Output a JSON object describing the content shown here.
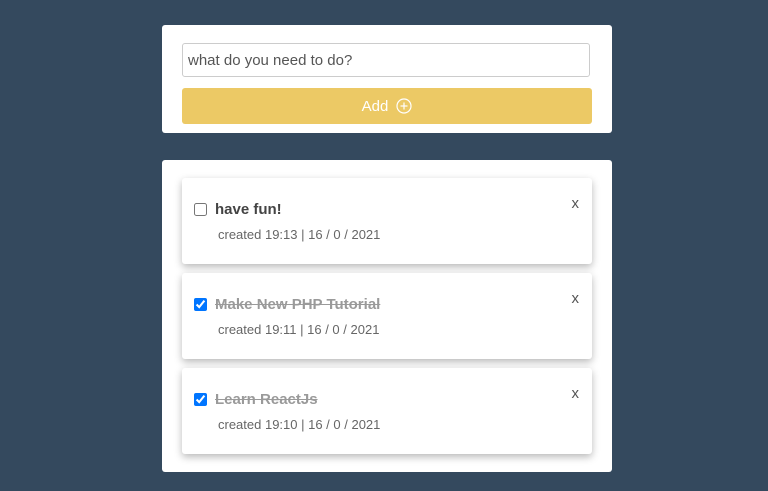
{
  "add_form": {
    "input_placeholder": "what do you need to do?",
    "input_value": "",
    "add_label": "Add",
    "add_icon": "plus-circle-icon"
  },
  "todos": [
    {
      "title": "have fun!",
      "created": "created 19:13 | 16 / 0 / 2021",
      "done": false,
      "delete_label": "x"
    },
    {
      "title": "Make New PHP Tutorial",
      "created": "created 19:11 | 16 / 0 / 2021",
      "done": true,
      "delete_label": "x"
    },
    {
      "title": "Learn ReactJs",
      "created": "created 19:10 | 16 / 0 / 2021",
      "done": true,
      "delete_label": "x"
    }
  ],
  "colors": {
    "background": "#34495e",
    "add_button": "#ecc965",
    "checkbox_accent": "#0075ff"
  }
}
